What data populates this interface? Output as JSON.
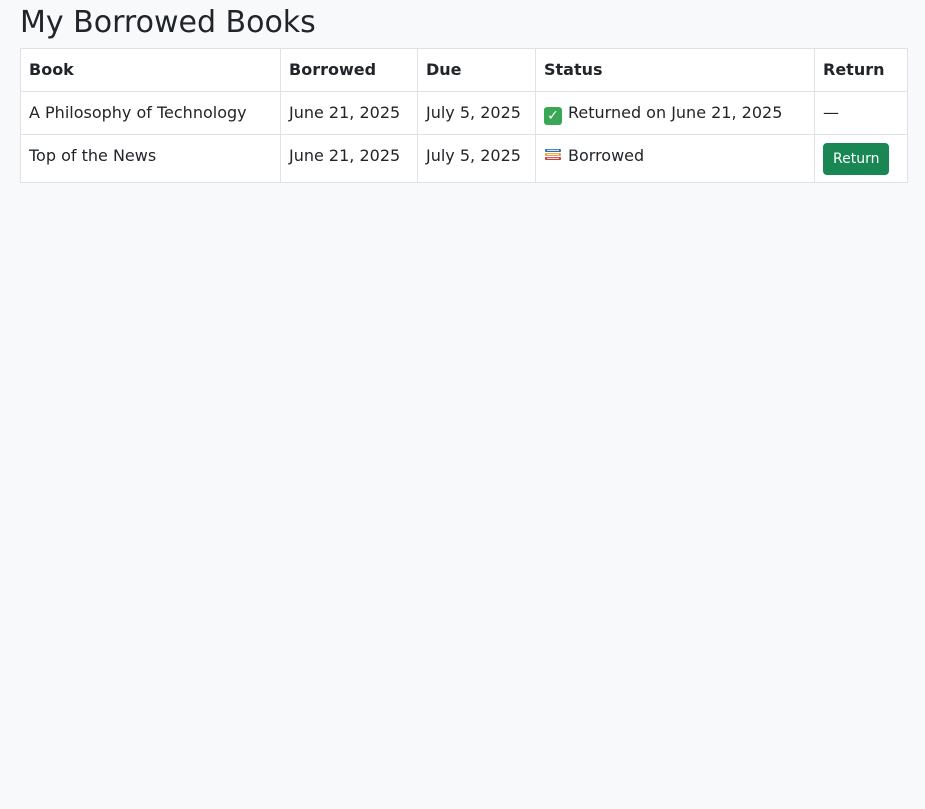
{
  "page": {
    "title": "My Borrowed Books"
  },
  "table": {
    "headers": [
      "Book",
      "Borrowed",
      "Due",
      "Status",
      "Return"
    ],
    "rows": [
      {
        "book": "A Philosophy of Technology",
        "borrowed": "June 21, 2025",
        "due": "July 5, 2025",
        "status_icon": "check-icon",
        "status": "Returned on June 21, 2025",
        "return": "—"
      },
      {
        "book": "Top of the News",
        "borrowed": "June 21, 2025",
        "due": "July 5, 2025",
        "status_icon": "books-icon",
        "status": "Borrowed",
        "return_button": "Return"
      }
    ]
  },
  "colors": {
    "background": "#f8f9fa",
    "return_button": "#198754",
    "check_icon": "#3aa757"
  }
}
